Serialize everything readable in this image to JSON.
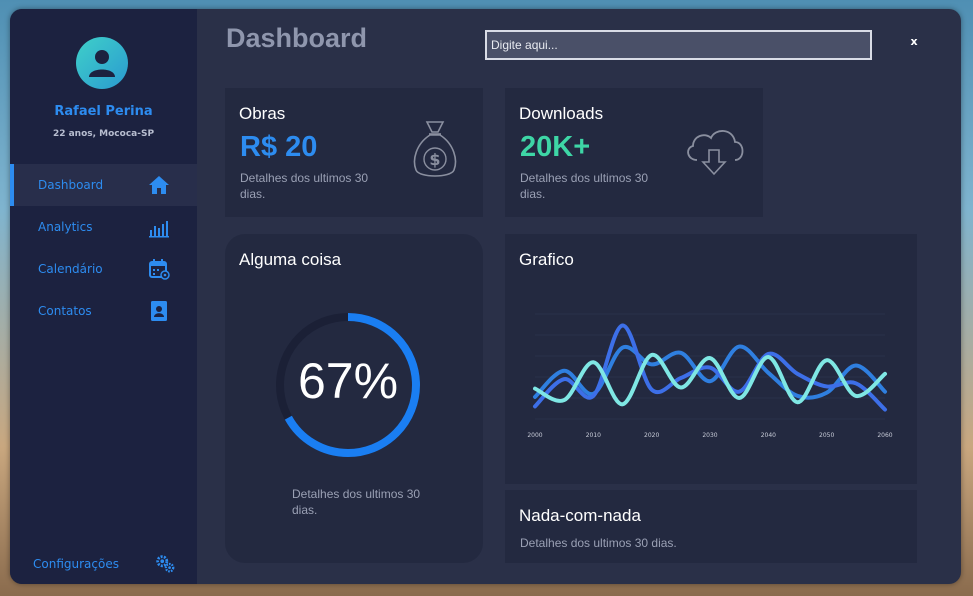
{
  "sidebar": {
    "user_name": "Rafael Perina",
    "user_info": "22 anos, Mococa-SP",
    "items": [
      {
        "label": "Dashboard",
        "icon": "home-icon"
      },
      {
        "label": "Analytics",
        "icon": "bar-chart-icon"
      },
      {
        "label": "Calendário",
        "icon": "calendar-icon"
      },
      {
        "label": "Contatos",
        "icon": "contacts-icon"
      }
    ],
    "config_label": "Configurações",
    "config_icon": "gears-icon"
  },
  "header": {
    "title": "Dashboard",
    "search_placeholder": "Digite aqui...",
    "close_label": "x"
  },
  "cards": {
    "obras": {
      "title": "Obras",
      "value": "R$ 20",
      "detail": "Detalhes dos ultimos 30 dias.",
      "icon": "money-bag-icon",
      "value_color": "#2d8cf0"
    },
    "downloads": {
      "title": "Downloads",
      "value": "20K+",
      "detail": "Detalhes dos ultimos 30 dias.",
      "icon": "cloud-download-icon",
      "value_color": "#3ed6a6"
    },
    "alguma": {
      "title": "Alguma coisa",
      "progress_label": "67%",
      "progress": 0.67,
      "detail": "Detalhes dos ultimos 30 dias."
    },
    "grafico": {
      "title": "Grafico"
    },
    "nada": {
      "title": "Nada-com-nada",
      "detail": "Detalhes dos ultimos 30 dias."
    }
  },
  "chart_data": {
    "type": "line",
    "title": "",
    "xlabel": "",
    "ylabel": "",
    "x": [
      2000,
      2005,
      2010,
      2015,
      2020,
      2025,
      2030,
      2035,
      2040,
      2045,
      2050,
      2055,
      2060
    ],
    "x_ticks": [
      "2000",
      "2010",
      "2020",
      "2030",
      "2040",
      "2050",
      "2060"
    ],
    "grid": true,
    "series": [
      {
        "values": [
          2.1,
          4.6,
          2.4,
          6.8,
          5.2,
          6.3,
          3.6,
          6.9,
          4.4,
          2.2,
          2.5,
          5.1,
          2.6
        ],
        "color": "#2f7fe0"
      },
      {
        "values": [
          1.2,
          3.8,
          2.2,
          8.9,
          2.8,
          3.9,
          4.9,
          2.6,
          6.2,
          4.3,
          3.1,
          3.4,
          0.9
        ],
        "color": "#3d6fe8"
      },
      {
        "values": [
          2.9,
          1.8,
          5.4,
          1.4,
          6.1,
          3.0,
          5.8,
          2.0,
          5.9,
          1.6,
          5.6,
          2.2,
          4.3
        ],
        "color": "#7fe7e4"
      }
    ],
    "ylim": [
      0,
      10
    ]
  }
}
